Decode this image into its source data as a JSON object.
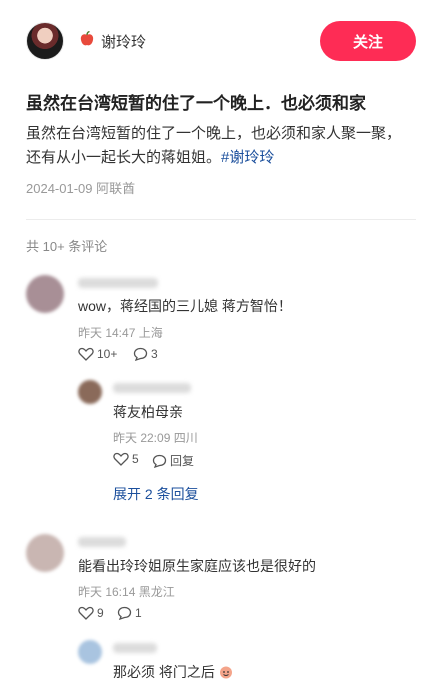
{
  "author": {
    "name": "谢玲玲"
  },
  "follow_label": "关注",
  "post": {
    "title": "虽然在台湾短暂的住了一个晚上．也必须和家",
    "body": "虽然在台湾短暂的住了一个晚上，也必须和家人聚一聚，还有从小一起长大的蒋姐姐。",
    "hashtag": "#谢玲玲",
    "meta": "2024-01-09 阿联酋"
  },
  "comments_header": "共 10+ 条评论",
  "comments": [
    {
      "text": "wow，蒋经国的三儿媳 蒋方智怡！",
      "meta": "昨天 14:47 上海",
      "likes": "10+",
      "replies": "3"
    },
    {
      "text": "能看出玲玲姐原生家庭应该也是很好的",
      "meta": "昨天 16:14 黑龙江",
      "likes": "9",
      "replies": "1"
    }
  ],
  "replies": [
    {
      "text": "蒋友柏母亲",
      "meta": "昨天 22:09 四川",
      "likes": "5",
      "reply_label": "回复"
    },
    {
      "text": "那必须 将门之后"
    }
  ],
  "expand_label": "展开 2 条回复",
  "colors": {
    "accent": "#fe2c55",
    "link": "#1b4f9c"
  }
}
